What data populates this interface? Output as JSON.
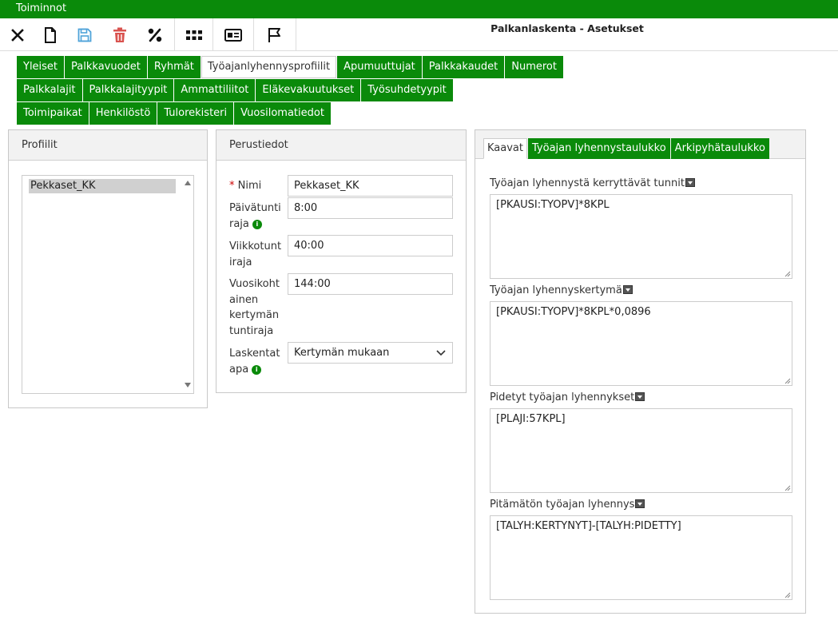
{
  "menubar": {
    "label": "Toiminnot"
  },
  "app": {
    "title": "Palkanlaskenta - Asetukset"
  },
  "toolbar": {
    "icons": [
      "close-icon",
      "new-document-icon",
      "save-icon",
      "delete-icon",
      "percent-icon",
      "apps-grid-icon",
      "id-card-icon",
      "flag-icon"
    ]
  },
  "tabs": {
    "row1": [
      {
        "label": "Yleiset"
      },
      {
        "label": "Palkkavuodet"
      },
      {
        "label": "Ryhmät"
      },
      {
        "label": "Työajanlyhennysprofiilit",
        "active": true
      },
      {
        "label": "Apumuuttujat"
      },
      {
        "label": "Palkkakaudet"
      },
      {
        "label": "Numerot"
      }
    ],
    "row2": [
      {
        "label": "Palkkalajit"
      },
      {
        "label": "Palkkalajityypit"
      },
      {
        "label": "Ammattiliitot"
      },
      {
        "label": "Eläkevakuutukset"
      },
      {
        "label": "Työsuhdetyypit"
      }
    ],
    "row3": [
      {
        "label": "Toimipaikat"
      },
      {
        "label": "Henkilöstö"
      },
      {
        "label": "Tulorekisteri"
      },
      {
        "label": "Vuosilomatiedot"
      }
    ]
  },
  "profiles": {
    "header": "Profiilit",
    "items": [
      "Pekkaset_KK"
    ]
  },
  "basic": {
    "header": "Perustiedot",
    "required_mark": "*",
    "name_label": "Nimi",
    "name_value": "Pekkaset_KK",
    "daily_label_1": "Päivätunti",
    "daily_label_2": "raja",
    "daily_value": "8:00",
    "weekly_label_1": "Viikkotunt",
    "weekly_label_2": "iraja",
    "weekly_value": "40:00",
    "yearly_label_1": "Vuosikoht",
    "yearly_label_2": "ainen",
    "yearly_label_3": "kertymän",
    "yearly_label_4": "tuntiraja",
    "yearly_value": "144:00",
    "calc_label_1": "Laskentat",
    "calc_label_2": "apa",
    "calc_value": "Kertymän mukaan",
    "info_glyph": "i"
  },
  "formulas": {
    "tabs": [
      {
        "label": "Kaavat",
        "active": true
      },
      {
        "label": "Työajan lyhennystaulukko"
      },
      {
        "label": "Arkipyhätaulukko"
      }
    ],
    "fields": [
      {
        "label": "Työajan lyhennystä kerryttävät tunnit",
        "value": "[PKAUSI:TYOPV]*8KPL"
      },
      {
        "label": "Työajan lyhennyskertymä",
        "value": "[PKAUSI:TYOPV]*8KPL*0,0896"
      },
      {
        "label": "Pidetyt työajan lyhennykset",
        "value": "[PLAJI:57KPL]"
      },
      {
        "label": "Pitämätön työajan lyhennys",
        "value": "[TALYH:KERTYNYT]-[TALYH:PIDETTY]"
      }
    ]
  },
  "colors": {
    "accent": "#0a8a0a",
    "delete": "#d9534f",
    "save": "#4fa3d9"
  }
}
